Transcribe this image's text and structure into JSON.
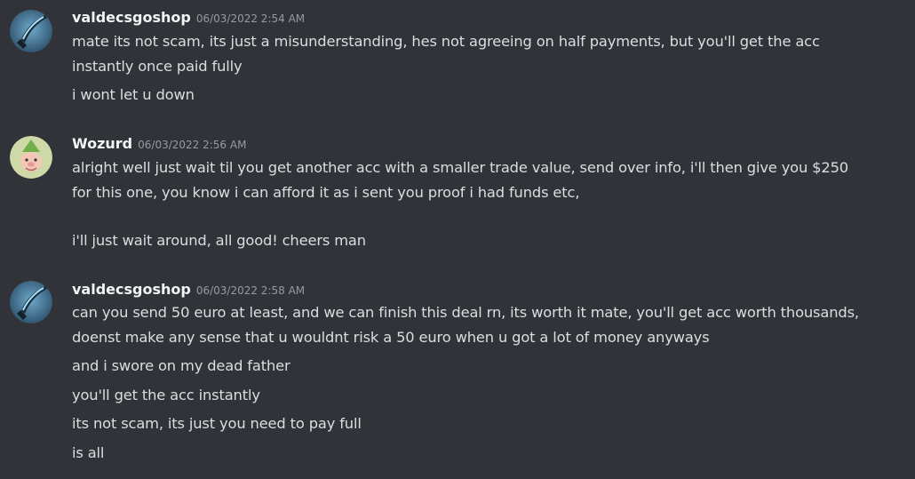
{
  "messages": [
    {
      "author": "valdecsgoshop",
      "timestamp": "06/03/2022 2:54 AM",
      "avatar_icon": "knife-skin-avatar-icon",
      "lines": [
        "mate its not scam, its just a misunderstanding, hes not agreeing on half payments, but you'll get the acc",
        "instantly once paid fully",
        "i wont let u down"
      ]
    },
    {
      "author": "Wozurd",
      "timestamp": "06/03/2022 2:56 AM",
      "avatar_icon": "gnome-face-avatar-icon",
      "lines": [
        "alright well just wait til you get another acc with a smaller trade value, send over info, i'll then give you $250",
        "for this one, you know i can afford it as i sent you proof i had funds etc,",
        "",
        "i'll just wait around, all good! cheers man"
      ]
    },
    {
      "author": "valdecsgoshop",
      "timestamp": "06/03/2022 2:58 AM",
      "avatar_icon": "knife-skin-avatar-icon",
      "lines": [
        "can you send 50 euro  at least, and we can finish this deal rn, its worth it mate, you'll get acc worth thousands,",
        "doenst make any sense that u wouldnt risk a 50 euro when u got a lot of money anyways",
        "and i swore on my dead father",
        "you'll get the acc instantly",
        "its not scam, its just you need to pay full",
        "is all"
      ]
    }
  ],
  "colors": {
    "background": "#313338",
    "username": "#f2f3f5",
    "timestamp": "#949ba4",
    "message_text": "#dbdee1"
  }
}
